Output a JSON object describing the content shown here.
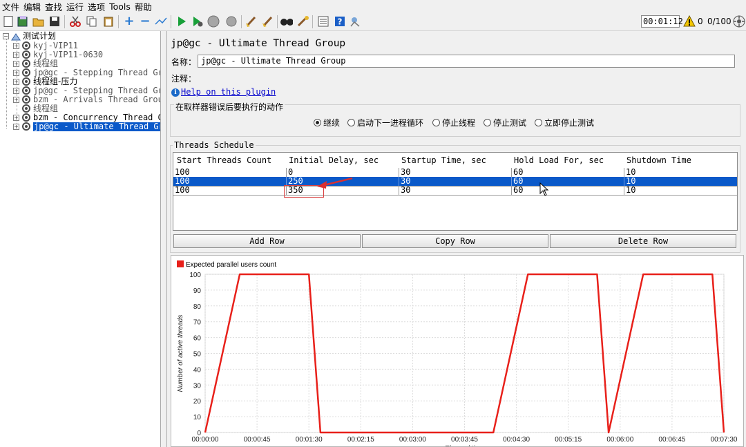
{
  "menu": [
    "文件",
    "编辑",
    "查找",
    "运行",
    "选项",
    "Tools",
    "帮助"
  ],
  "toolbar": {
    "timer": "00:01:12",
    "warning_count": "0",
    "threads": "0/100",
    "icons": [
      "new-icon",
      "templates-icon",
      "open-icon",
      "save-icon",
      "cut-icon",
      "copy-icon",
      "paste-icon",
      "expand-icon",
      "collapse-icon",
      "toggle-icon",
      "start-icon",
      "start-no-pause-icon",
      "stop-icon",
      "shutdown-icon",
      "clear-icon",
      "clear-all-icon",
      "search-icon",
      "reset-search-icon",
      "function-helper-icon",
      "help-icon",
      "remote-icon"
    ]
  },
  "tree": {
    "root": "测试计划",
    "items": [
      {
        "label": "kyj-VIP11",
        "dim": true
      },
      {
        "label": "kyj-VIP11-0630",
        "dim": true
      },
      {
        "label": "线程组",
        "dim": true
      },
      {
        "label": "jp@gc - Stepping Thread Grou",
        "dim": true
      },
      {
        "label": "线程组-压力",
        "dim": false
      },
      {
        "label": "jp@gc - Stepping Thread Grou",
        "dim": true
      },
      {
        "label": "bzm - Arrivals Thread Group",
        "dim": true
      },
      {
        "label": "线程组",
        "dim": true
      },
      {
        "label": "bzm - Concurrency Thread Gro",
        "dim": false
      },
      {
        "label": "jp@gc - Ultimate Thread Grou",
        "dim": false,
        "selected": true
      }
    ]
  },
  "panel": {
    "title": "jp@gc - Ultimate Thread Group",
    "name_label": "名称：",
    "name_value": "jp@gc - Ultimate Thread Group",
    "comment_label": "注释：",
    "help_link": "Help on this plugin",
    "error_legend": "在取样器错误后要执行的动作",
    "error_options": [
      {
        "label": "继续",
        "selected": true
      },
      {
        "label": "启动下一进程循环",
        "selected": false
      },
      {
        "label": "停止线程",
        "selected": false
      },
      {
        "label": "停止测试",
        "selected": false
      },
      {
        "label": "立即停止测试",
        "selected": false
      }
    ]
  },
  "schedule": {
    "legend": "Threads Schedule",
    "columns": [
      "Start Threads Count",
      "Initial Delay, sec",
      "Startup Time, sec",
      "Hold Load For, sec",
      "Shutdown Time"
    ],
    "rows": [
      [
        "100",
        "0",
        "30",
        "60",
        "10"
      ],
      [
        "100",
        "250",
        "30",
        "60",
        "10"
      ],
      [
        "100",
        "350",
        "30",
        "60",
        "10"
      ]
    ],
    "selected_row": 1,
    "buttons": {
      "add": "Add Row",
      "copy": "Copy Row",
      "delete": "Delete Row"
    }
  },
  "colors": {
    "accent": "#0a59c9",
    "series": "#e8201a",
    "annotation": "#d94040"
  },
  "chart_data": {
    "type": "line",
    "legend": "Expected parallel users count",
    "ylabel": "Number of active threads",
    "xlabel": "Elapsed time",
    "ylim": [
      0,
      100
    ],
    "yticks": [
      0,
      10,
      20,
      30,
      40,
      50,
      60,
      70,
      80,
      90,
      100
    ],
    "xlim": [
      0,
      450
    ],
    "xticks": [
      0,
      45,
      90,
      135,
      180,
      225,
      270,
      315,
      360,
      405,
      450
    ],
    "xtick_labels": [
      "00:00:00",
      "00:00:45",
      "00:01:30",
      "00:02:15",
      "00:03:00",
      "00:03:45",
      "00:04:30",
      "00:05:15",
      "00:06:00",
      "00:06:45",
      "00:07:30"
    ],
    "series": [
      {
        "name": "Expected parallel users count",
        "x": [
          0,
          30,
          90,
          100,
          250,
          280,
          340,
          350,
          350,
          380,
          440,
          450
        ],
        "y": [
          0,
          100,
          100,
          0,
          0,
          100,
          100,
          0,
          0,
          100,
          100,
          0
        ]
      }
    ]
  }
}
